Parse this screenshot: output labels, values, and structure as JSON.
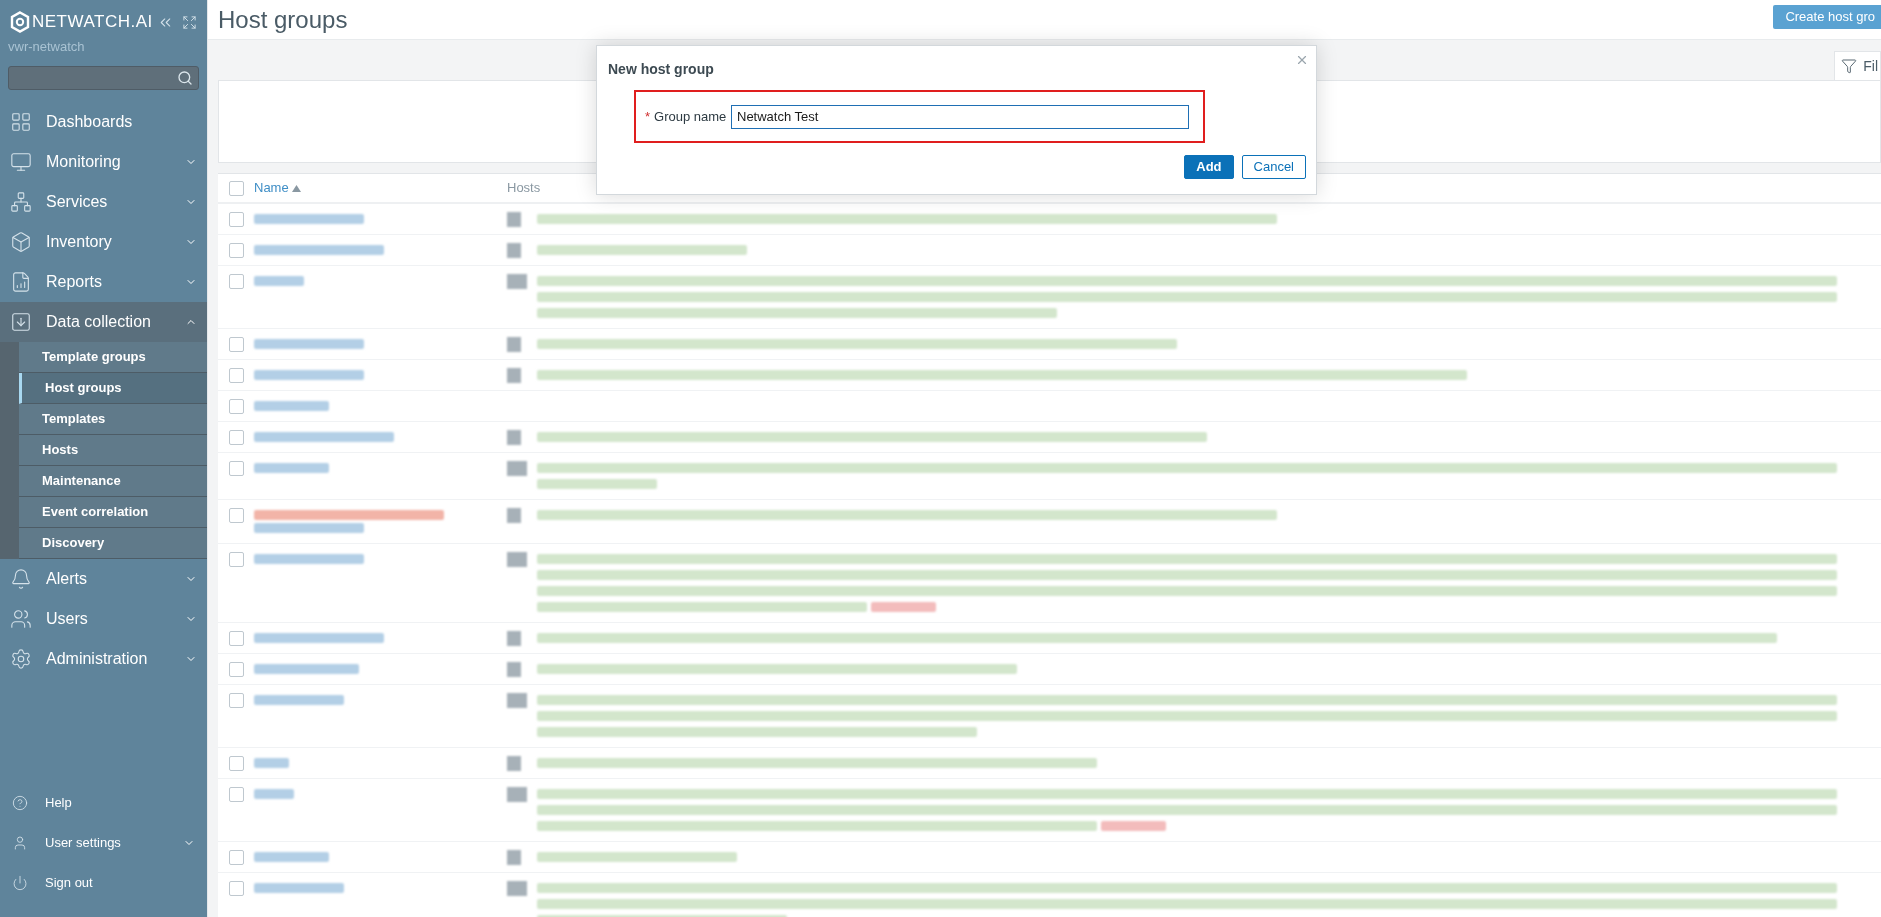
{
  "sidebar": {
    "logo": "NETWATCH.AI",
    "server": "vwr-netwatch",
    "items": [
      {
        "label": "Dashboards",
        "kind": "dashboards"
      },
      {
        "label": "Monitoring",
        "kind": "monitoring",
        "expanded": false
      },
      {
        "label": "Services",
        "kind": "services",
        "expanded": false
      },
      {
        "label": "Inventory",
        "kind": "inventory",
        "expanded": false
      },
      {
        "label": "Reports",
        "kind": "reports",
        "expanded": false
      },
      {
        "label": "Data collection",
        "kind": "data",
        "expanded": true,
        "children": [
          {
            "label": "Template groups",
            "selected": false
          },
          {
            "label": "Host groups",
            "selected": true
          },
          {
            "label": "Templates",
            "selected": false
          },
          {
            "label": "Hosts",
            "selected": false
          },
          {
            "label": "Maintenance",
            "selected": false
          },
          {
            "label": "Event correlation",
            "selected": false
          },
          {
            "label": "Discovery",
            "selected": false
          }
        ]
      },
      {
        "label": "Alerts",
        "kind": "alerts",
        "expanded": false
      },
      {
        "label": "Users",
        "kind": "users",
        "expanded": false
      },
      {
        "label": "Administration",
        "kind": "administration",
        "expanded": false
      }
    ],
    "bottom": [
      {
        "label": "Help",
        "kind": "help"
      },
      {
        "label": "User settings",
        "kind": "user",
        "expanded": false
      },
      {
        "label": "Sign out",
        "kind": "signout"
      }
    ]
  },
  "page": {
    "title": "Host groups",
    "create_button": "Create host gro",
    "filter_tab": "Fil"
  },
  "table": {
    "select_all_checked": false,
    "columns": [
      {
        "label": "Name",
        "sorted": true
      },
      {
        "label": "Hosts",
        "sorted": false
      }
    ],
    "rows": [
      {
        "checked": false,
        "discovered": false,
        "alert_host": false
      },
      {
        "checked": false,
        "discovered": false,
        "alert_host": false
      },
      {
        "checked": false,
        "discovered": false,
        "alert_host": false
      },
      {
        "checked": false,
        "discovered": false,
        "alert_host": false
      },
      {
        "checked": false,
        "discovered": false,
        "alert_host": false
      },
      {
        "checked": false,
        "discovered": false,
        "alert_host": false
      },
      {
        "checked": false,
        "discovered": false,
        "alert_host": false
      },
      {
        "checked": false,
        "discovered": false,
        "alert_host": false
      },
      {
        "checked": false,
        "discovered": true,
        "alert_host": false
      },
      {
        "checked": false,
        "discovered": false,
        "alert_host": true
      },
      {
        "checked": false,
        "discovered": false,
        "alert_host": false
      },
      {
        "checked": false,
        "discovered": false,
        "alert_host": false
      },
      {
        "checked": false,
        "discovered": false,
        "alert_host": false
      },
      {
        "checked": false,
        "discovered": false,
        "alert_host": false
      },
      {
        "checked": false,
        "discovered": false,
        "alert_host": true
      },
      {
        "checked": false,
        "discovered": false,
        "alert_host": false
      },
      {
        "checked": false,
        "discovered": false,
        "alert_host": false
      }
    ]
  },
  "dialog": {
    "title": "New host group",
    "field": {
      "label": "Group name",
      "required_mark": "*",
      "value": "Netwatch Test",
      "highlighted": true
    },
    "buttons": [
      {
        "label": "Add",
        "primary": true
      },
      {
        "label": "Cancel",
        "primary": false
      }
    ]
  }
}
